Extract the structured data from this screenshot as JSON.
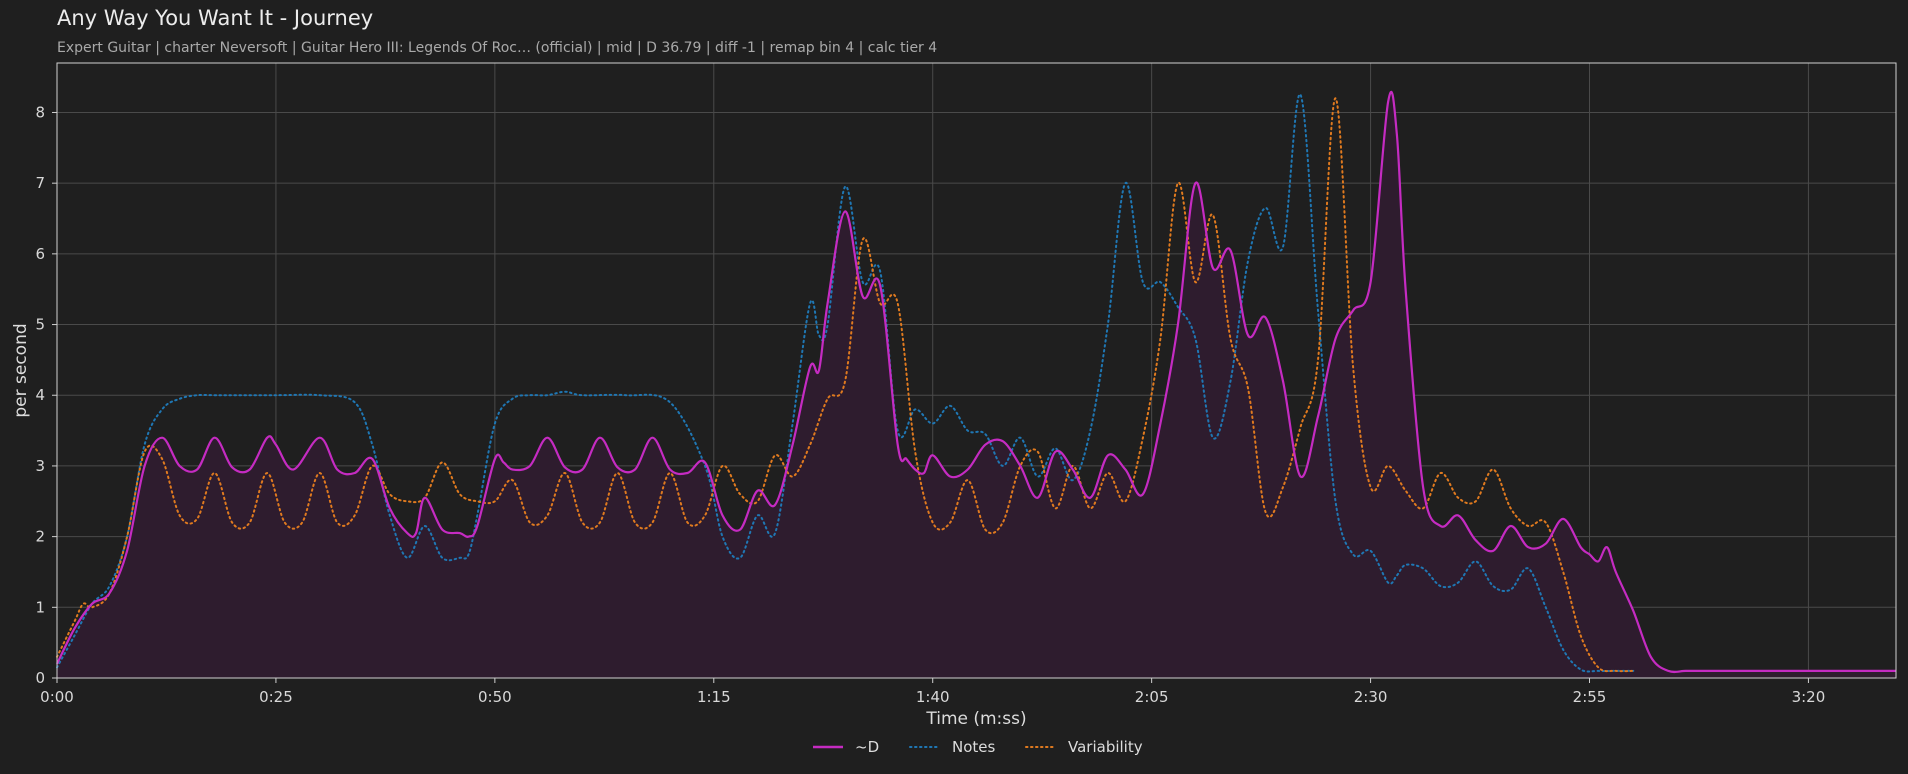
{
  "header": {
    "title": "Any Way You Want It - Journey",
    "subtitle": "Expert Guitar  |  charter Neversoft  |  Guitar Hero III: Legends Of Roc… (official)  |  mid  |  D 36.79  |  diff -1  |  remap bin 4  |  calc tier 4"
  },
  "colors": {
    "background": "#1f1f1f",
    "grid": "#4a4a4a",
    "D": "#c52bc2",
    "D_fill": "#2e1c2e",
    "Notes": "#1f77b4",
    "Variability": "#e07a1f"
  },
  "chart_data": {
    "type": "line",
    "title": "Any Way You Want It - Journey",
    "xlabel": "Time (m:ss)",
    "ylabel": "per second",
    "xlim": [
      0,
      210
    ],
    "ylim": [
      0,
      8.7
    ],
    "grid": true,
    "legend_position": "bottom-center",
    "x_ticks": [
      0,
      25,
      50,
      75,
      100,
      125,
      150,
      175,
      200
    ],
    "x_tick_labels": [
      "0:00",
      "0:25",
      "0:50",
      "1:15",
      "1:40",
      "2:05",
      "2:30",
      "2:55",
      "3:20"
    ],
    "y_ticks": [
      0,
      1,
      2,
      3,
      4,
      5,
      6,
      7,
      8
    ],
    "y_tick_labels": [
      "0",
      "1",
      "2",
      "3",
      "4",
      "5",
      "6",
      "7",
      "8"
    ],
    "series": [
      {
        "name": "~D",
        "style": "solid",
        "filled": true,
        "x": [
          0,
          2,
          4,
          6,
          8,
          10,
          12,
          14,
          16,
          18,
          20,
          22,
          24,
          25,
          27,
          30,
          32,
          34,
          36,
          38,
          40,
          41,
          42,
          44,
          46,
          47,
          48,
          50,
          51,
          52,
          54,
          56,
          58,
          60,
          62,
          64,
          66,
          68,
          70,
          72,
          74,
          76,
          78,
          80,
          82,
          84,
          86,
          87,
          88,
          90,
          92,
          94,
          96,
          97,
          98,
          99,
          100,
          102,
          104,
          106,
          108,
          110,
          112,
          114,
          116,
          118,
          120,
          122,
          124,
          126,
          128,
          130,
          132,
          134,
          136,
          138,
          140,
          142,
          144,
          146,
          148,
          150,
          152,
          153,
          154,
          156,
          158,
          160,
          162,
          164,
          166,
          168,
          170,
          172,
          174,
          175,
          176,
          177,
          178,
          180,
          182,
          184,
          186,
          188,
          190,
          192,
          194,
          196,
          198,
          200,
          202,
          204,
          206,
          208,
          210
        ],
        "values": [
          0.2,
          0.7,
          1.05,
          1.2,
          1.8,
          3.0,
          3.4,
          3.0,
          2.95,
          3.4,
          2.98,
          2.95,
          3.4,
          3.3,
          2.95,
          3.4,
          2.95,
          2.9,
          3.1,
          2.4,
          2.05,
          2.05,
          2.55,
          2.1,
          2.05,
          2.0,
          2.15,
          3.1,
          3.05,
          2.95,
          3.0,
          3.4,
          2.98,
          2.95,
          3.4,
          2.98,
          2.95,
          3.4,
          2.95,
          2.9,
          3.05,
          2.3,
          2.1,
          2.65,
          2.45,
          3.3,
          4.4,
          4.35,
          5.3,
          6.6,
          5.4,
          5.55,
          3.3,
          3.1,
          2.95,
          2.9,
          3.15,
          2.85,
          2.95,
          3.3,
          3.35,
          3.0,
          2.55,
          3.2,
          2.95,
          2.55,
          3.15,
          2.95,
          2.6,
          3.6,
          5.0,
          7.0,
          5.8,
          6.05,
          4.85,
          5.1,
          4.2,
          2.85,
          3.7,
          4.8,
          5.2,
          5.6,
          8.15,
          7.7,
          5.5,
          2.7,
          2.15,
          2.3,
          1.95,
          1.8,
          2.15,
          1.85,
          1.9,
          2.25,
          1.85,
          1.75,
          1.65,
          1.85,
          1.5,
          0.95,
          0.3,
          0.1,
          0.1,
          0.1,
          0.1,
          0.1,
          0.1,
          0.1,
          0.1,
          0.1,
          0.1,
          0.1,
          0.1,
          0.1,
          0.1
        ]
      },
      {
        "name": "Notes",
        "style": "dotted",
        "filled": false,
        "x": [
          0,
          2,
          4,
          6,
          8,
          10,
          12,
          14,
          16,
          18,
          20,
          25,
          30,
          34,
          36,
          38,
          40,
          42,
          44,
          46,
          47,
          48,
          50,
          52,
          54,
          56,
          58,
          60,
          65,
          70,
          74,
          76,
          78,
          80,
          82,
          84,
          86,
          87,
          88,
          90,
          92,
          94,
          96,
          98,
          100,
          102,
          104,
          106,
          108,
          110,
          112,
          114,
          116,
          118,
          120,
          122,
          124,
          126,
          128,
          130,
          132,
          134,
          136,
          138,
          140,
          142,
          144,
          146,
          148,
          150,
          152,
          153,
          154,
          156,
          158,
          160,
          162,
          164,
          166,
          168,
          170,
          172,
          174,
          176,
          178,
          180
        ],
        "values": [
          0.15,
          0.6,
          1.05,
          1.3,
          2.0,
          3.3,
          3.8,
          3.95,
          4.0,
          4.0,
          4.0,
          4.0,
          4.0,
          3.9,
          3.3,
          2.3,
          1.7,
          2.15,
          1.7,
          1.7,
          1.75,
          2.3,
          3.6,
          3.95,
          4.0,
          4.0,
          4.05,
          4.0,
          4.0,
          3.9,
          3.0,
          2.0,
          1.7,
          2.3,
          2.05,
          3.6,
          5.3,
          4.85,
          5.0,
          6.95,
          5.6,
          5.75,
          3.5,
          3.8,
          3.6,
          3.85,
          3.5,
          3.45,
          3.0,
          3.4,
          2.85,
          3.25,
          2.8,
          3.5,
          5.0,
          7.0,
          5.6,
          5.6,
          5.25,
          4.8,
          3.4,
          4.2,
          5.9,
          6.65,
          6.1,
          8.25,
          5.2,
          2.5,
          1.75,
          1.8,
          1.35,
          1.45,
          1.6,
          1.55,
          1.3,
          1.35,
          1.65,
          1.3,
          1.25,
          1.55,
          1.0,
          0.4,
          0.12,
          0.1,
          0.1,
          0.1
        ]
      },
      {
        "name": "Variability",
        "style": "dotted",
        "filled": false,
        "x": [
          0,
          2,
          3,
          4,
          6,
          8,
          10,
          12,
          14,
          16,
          18,
          20,
          22,
          24,
          26,
          28,
          30,
          32,
          34,
          36,
          38,
          40,
          42,
          44,
          46,
          48,
          50,
          52,
          54,
          56,
          58,
          60,
          62,
          64,
          66,
          68,
          70,
          72,
          74,
          76,
          78,
          80,
          82,
          84,
          86,
          88,
          90,
          92,
          94,
          96,
          98,
          100,
          102,
          104,
          106,
          108,
          110,
          112,
          114,
          116,
          118,
          120,
          122,
          124,
          126,
          128,
          130,
          132,
          134,
          136,
          138,
          140,
          142,
          144,
          146,
          148,
          150,
          152,
          154,
          156,
          158,
          160,
          162,
          164,
          166,
          168,
          170,
          172,
          174,
          176,
          178,
          180
        ],
        "values": [
          0.3,
          0.8,
          1.05,
          1.0,
          1.2,
          2.0,
          3.2,
          3.1,
          2.3,
          2.25,
          2.9,
          2.2,
          2.2,
          2.9,
          2.2,
          2.2,
          2.9,
          2.2,
          2.3,
          3.0,
          2.6,
          2.5,
          2.55,
          3.05,
          2.6,
          2.5,
          2.5,
          2.8,
          2.2,
          2.3,
          2.9,
          2.2,
          2.2,
          2.9,
          2.2,
          2.2,
          2.9,
          2.2,
          2.3,
          3.0,
          2.6,
          2.5,
          3.15,
          2.85,
          3.3,
          3.95,
          4.2,
          6.2,
          5.3,
          5.3,
          3.2,
          2.2,
          2.2,
          2.8,
          2.1,
          2.2,
          3.0,
          3.2,
          2.4,
          3.0,
          2.4,
          2.9,
          2.5,
          3.4,
          4.8,
          7.0,
          5.6,
          6.55,
          4.8,
          4.1,
          2.35,
          2.7,
          3.55,
          4.5,
          8.2,
          4.4,
          2.7,
          3.0,
          2.65,
          2.4,
          2.9,
          2.55,
          2.5,
          2.95,
          2.4,
          2.15,
          2.2,
          1.5,
          0.6,
          0.15,
          0.1,
          0.1
        ]
      }
    ]
  }
}
